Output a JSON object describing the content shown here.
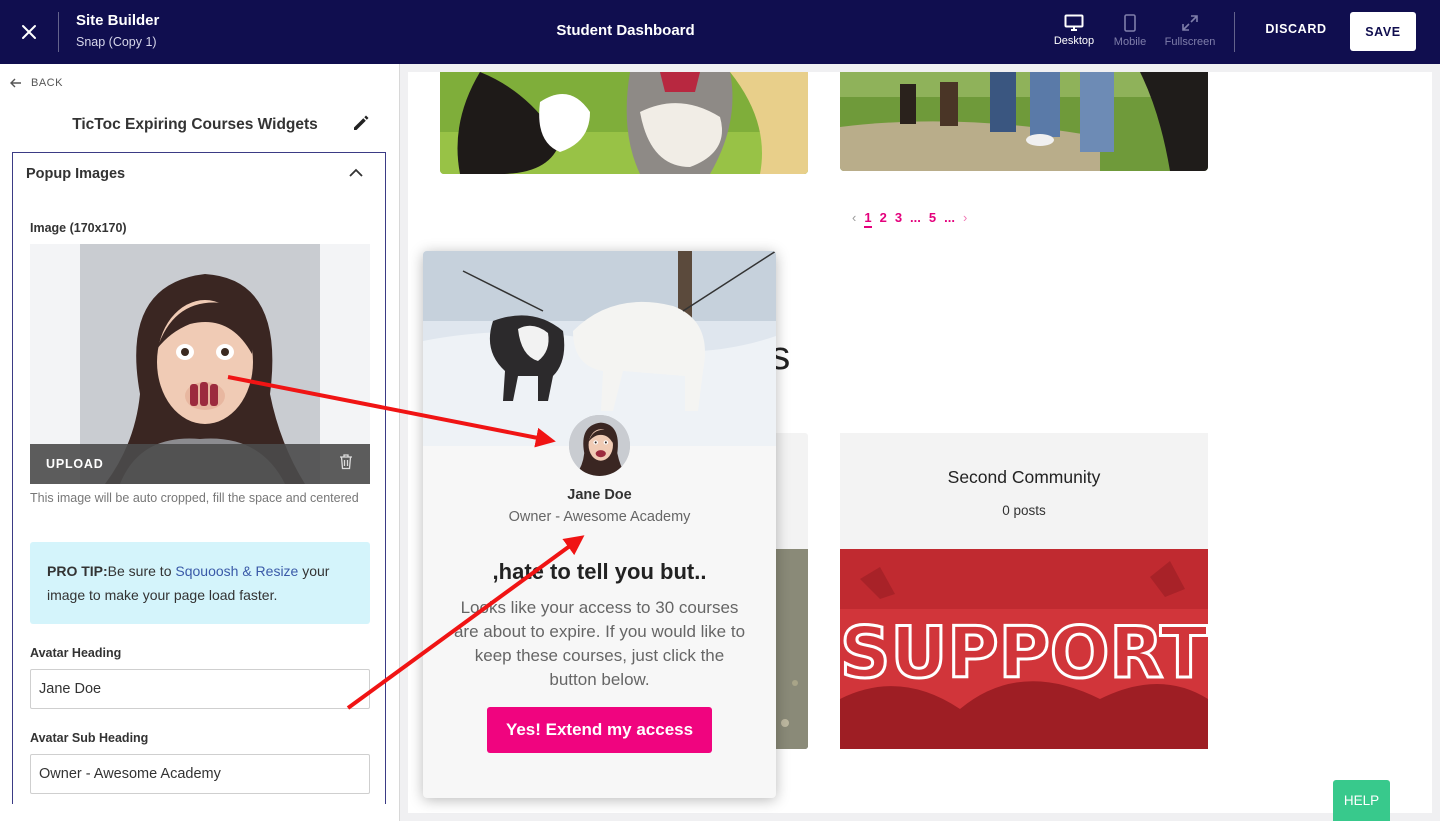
{
  "topbar": {
    "app_title": "Site Builder",
    "app_subtitle": "Snap (Copy 1)",
    "page_title": "Student Dashboard",
    "devices": [
      {
        "label": "Desktop",
        "icon": "desktop-icon",
        "active": true
      },
      {
        "label": "Mobile",
        "icon": "mobile-icon",
        "active": false
      },
      {
        "label": "Fullscreen",
        "icon": "fullscreen-icon",
        "active": false
      }
    ],
    "discard_label": "DISCARD",
    "save_label": "SAVE"
  },
  "sidebar": {
    "back_label": "BACK",
    "widget_title": "TicToc Expiring Courses Widgets",
    "section_title": "Popup Images",
    "image_label": "Image (170x170)",
    "upload_label": "UPLOAD",
    "image_help": "This image will be auto cropped, fill the space and centered",
    "pro_tip": {
      "bold": "PRO TIP:",
      "before_link": "Be sure to ",
      "link": "Sqouoosh & Resize",
      "after_link": " your image to make your page load faster."
    },
    "avatar_heading_label": "Avatar Heading",
    "avatar_heading_value": "Jane Doe",
    "avatar_subheading_label": "Avatar Sub Heading",
    "avatar_subheading_value": "Owner - Awesome Academy"
  },
  "canvas": {
    "pagination": {
      "prev": "‹",
      "pages": [
        "1",
        "2",
        "3",
        "...",
        "5",
        "..."
      ],
      "active_index": 0,
      "next": "›"
    },
    "section_heading_fragment": "es",
    "community": {
      "title": "Second Community",
      "posts": "0 posts",
      "image_text": "SUPPORT"
    }
  },
  "popup": {
    "name": "Jane Doe",
    "subtitle": "Owner - Awesome Academy",
    "heading": ",hate to tell you but..",
    "body": "Looks like your access to 30 courses are about to expire. If you would like to keep these courses, just click the button below.",
    "cta": "Yes! Extend my access"
  },
  "help_label": "HELP",
  "colors": {
    "topbar": "#100e4f",
    "accent_pink": "#f0047f",
    "annotation_arrow": "#f01414",
    "help_green": "#38c98c",
    "pro_tip_bg": "#d4f4fb"
  }
}
